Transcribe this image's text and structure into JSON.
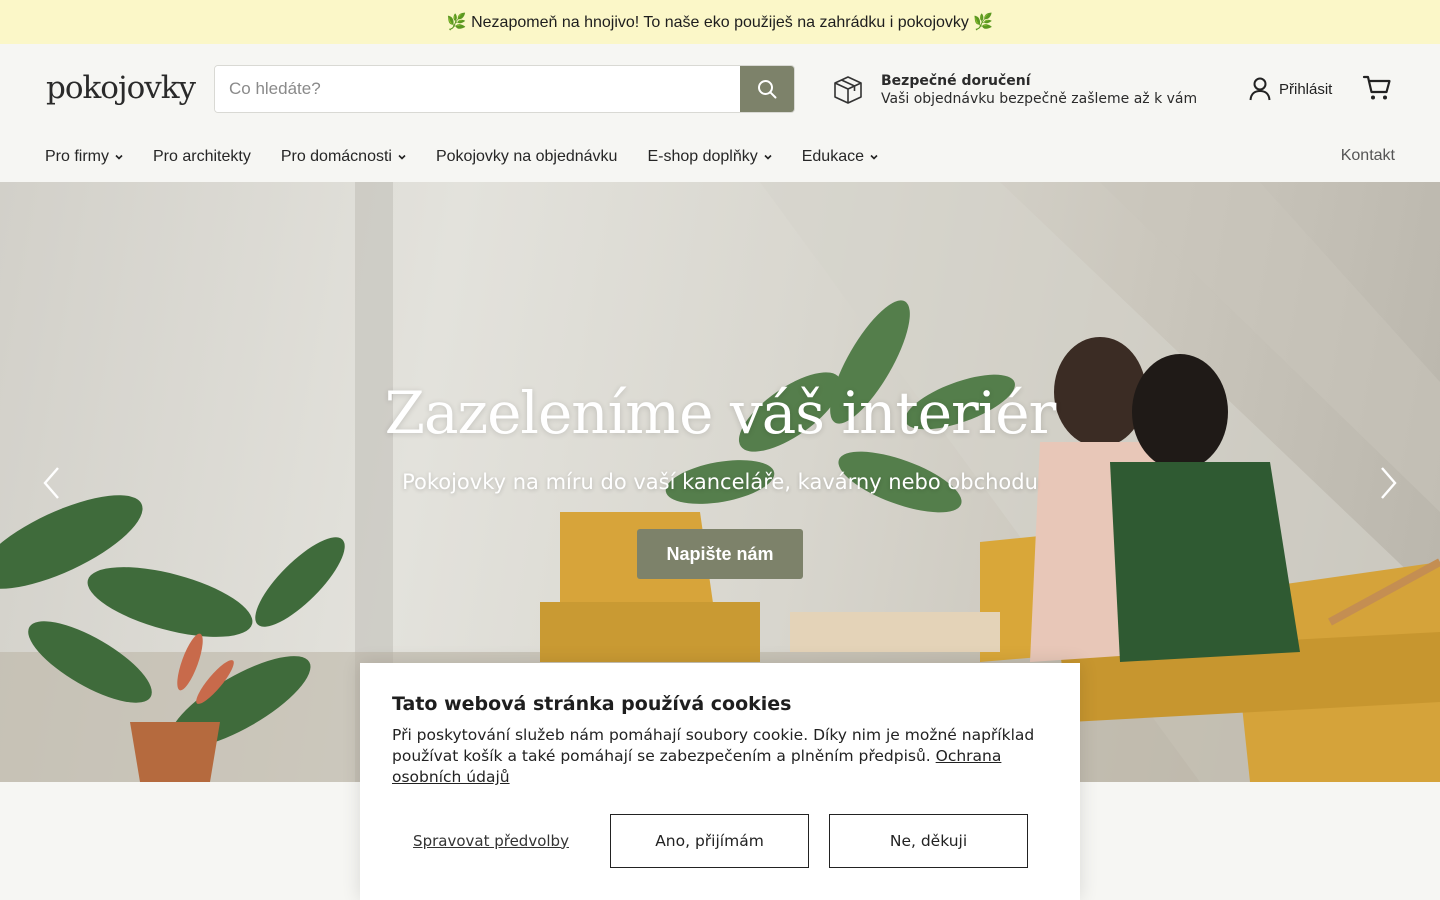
{
  "announcement": {
    "text": "🌿 Nezapomeň na hnojivo! To naše eko použiješ na zahrádku i pokojovky 🌿"
  },
  "header": {
    "logo": "pokojovky",
    "search_placeholder": "Co hledáte?",
    "delivery_title": "Bezpečné doručení",
    "delivery_subtitle": "Vaši objednávku bezpečně zašleme až k vám",
    "login_label": "Přihlásit"
  },
  "nav": {
    "items": [
      {
        "label": "Pro firmy",
        "dropdown": true
      },
      {
        "label": "Pro architekty",
        "dropdown": false
      },
      {
        "label": "Pro domácnosti",
        "dropdown": true
      },
      {
        "label": "Pokojovky na objednávku",
        "dropdown": false
      },
      {
        "label": "E-shop doplňky",
        "dropdown": true
      },
      {
        "label": "Edukace",
        "dropdown": true
      }
    ],
    "contact": "Kontakt"
  },
  "hero": {
    "title": "Zazeleníme váš interiér",
    "subtitle": "Pokojovky na míru do vaší kanceláře, kavárny nebo obchodu",
    "cta": "Napište nám"
  },
  "cookie": {
    "title": "Tato webová stránka používá cookies",
    "text": "Při poskytování služeb nám pomáhají soubory cookie. Díky nim je možné například používat košík a také pomáhají se zabezpečením a plněním předpisů.",
    "privacy_link": "Ochrana osobních údajů",
    "manage": "Spravovat předvolby",
    "accept": "Ano, přijímám",
    "decline": "Ne, děkuji"
  },
  "colors": {
    "accent": "#7d826a",
    "announcement_bg": "#fbf7c8",
    "header_bg": "#f6f6f3"
  },
  "icons": [
    "search-icon",
    "package-icon",
    "user-icon",
    "cart-icon",
    "chevron-down-icon",
    "arrow-left-icon",
    "arrow-right-icon"
  ]
}
